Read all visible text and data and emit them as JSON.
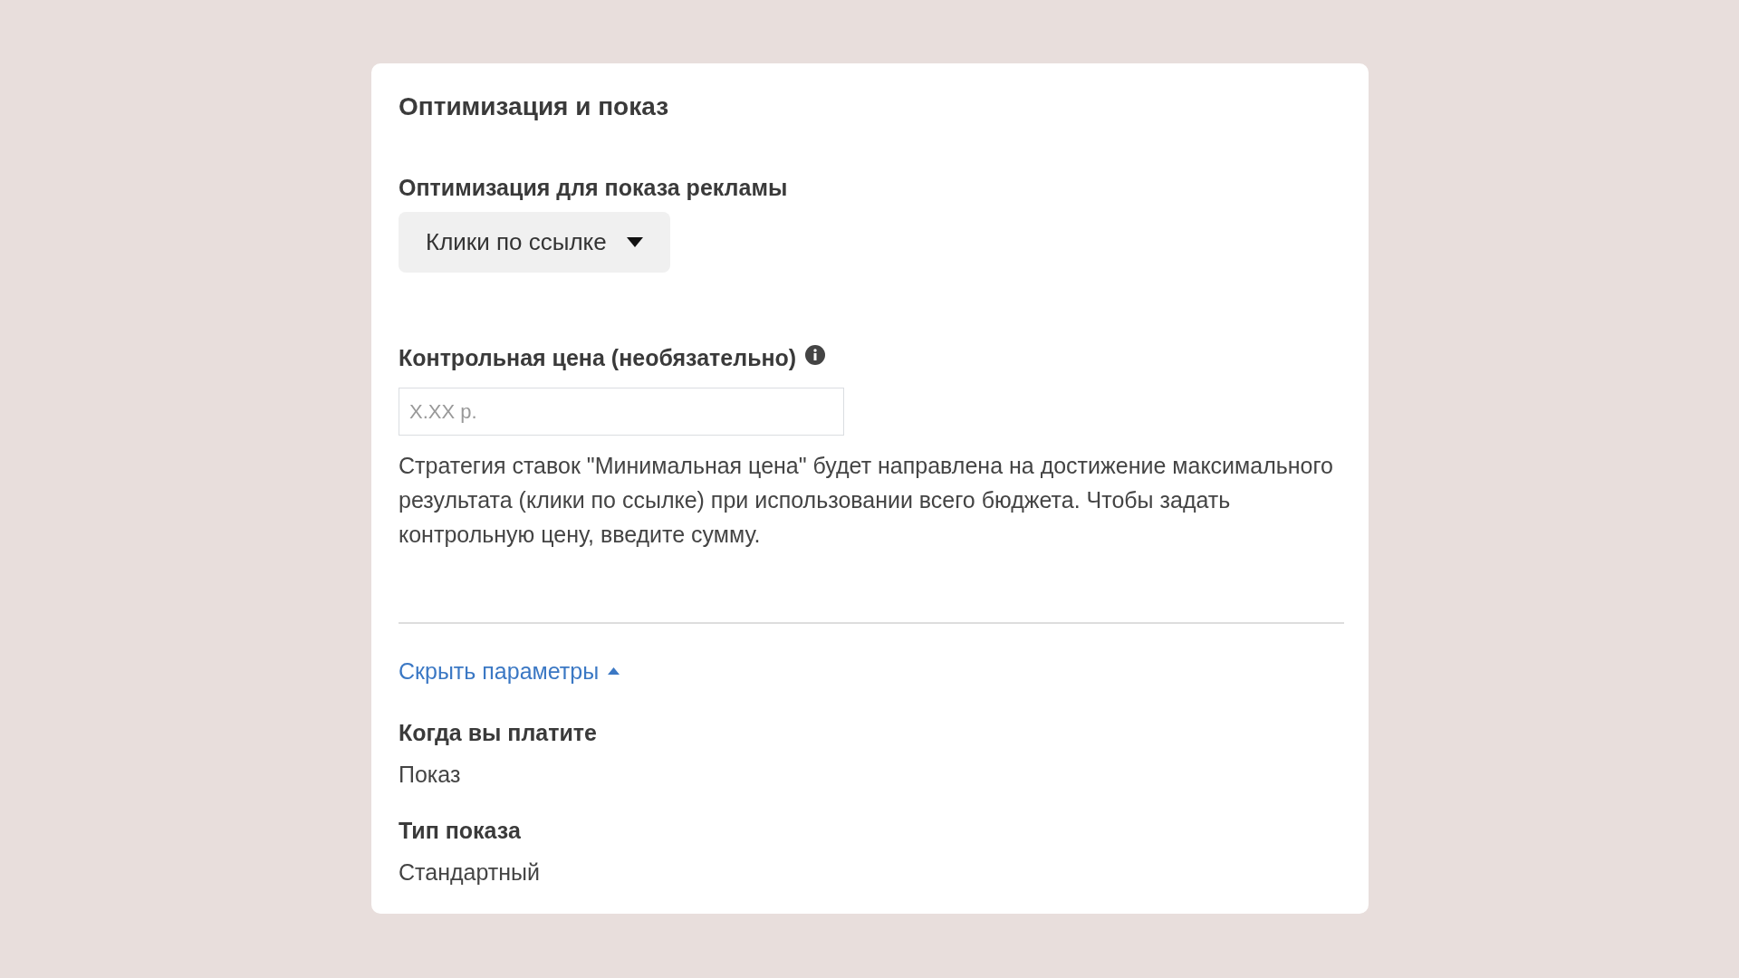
{
  "card": {
    "title": "Оптимизация и показ",
    "optimization": {
      "label": "Оптимизация для показа рекламы",
      "value": "Клики по ссылке"
    },
    "bid_control": {
      "label": "Контрольная цена (необязательно)",
      "placeholder": "X.XX р.",
      "description": "Стратегия ставок \"Минимальная цена\" будет направлена на достижение максимального результата (клики по ссылке) при использовании всего бюджета. Чтобы задать контрольную цену, введите сумму."
    },
    "toggle": {
      "label": "Скрыть параметры",
      "expanded": true
    },
    "details": [
      {
        "label": "Когда вы платите",
        "value": "Показ"
      },
      {
        "label": "Тип показа",
        "value": "Стандартный"
      }
    ]
  }
}
